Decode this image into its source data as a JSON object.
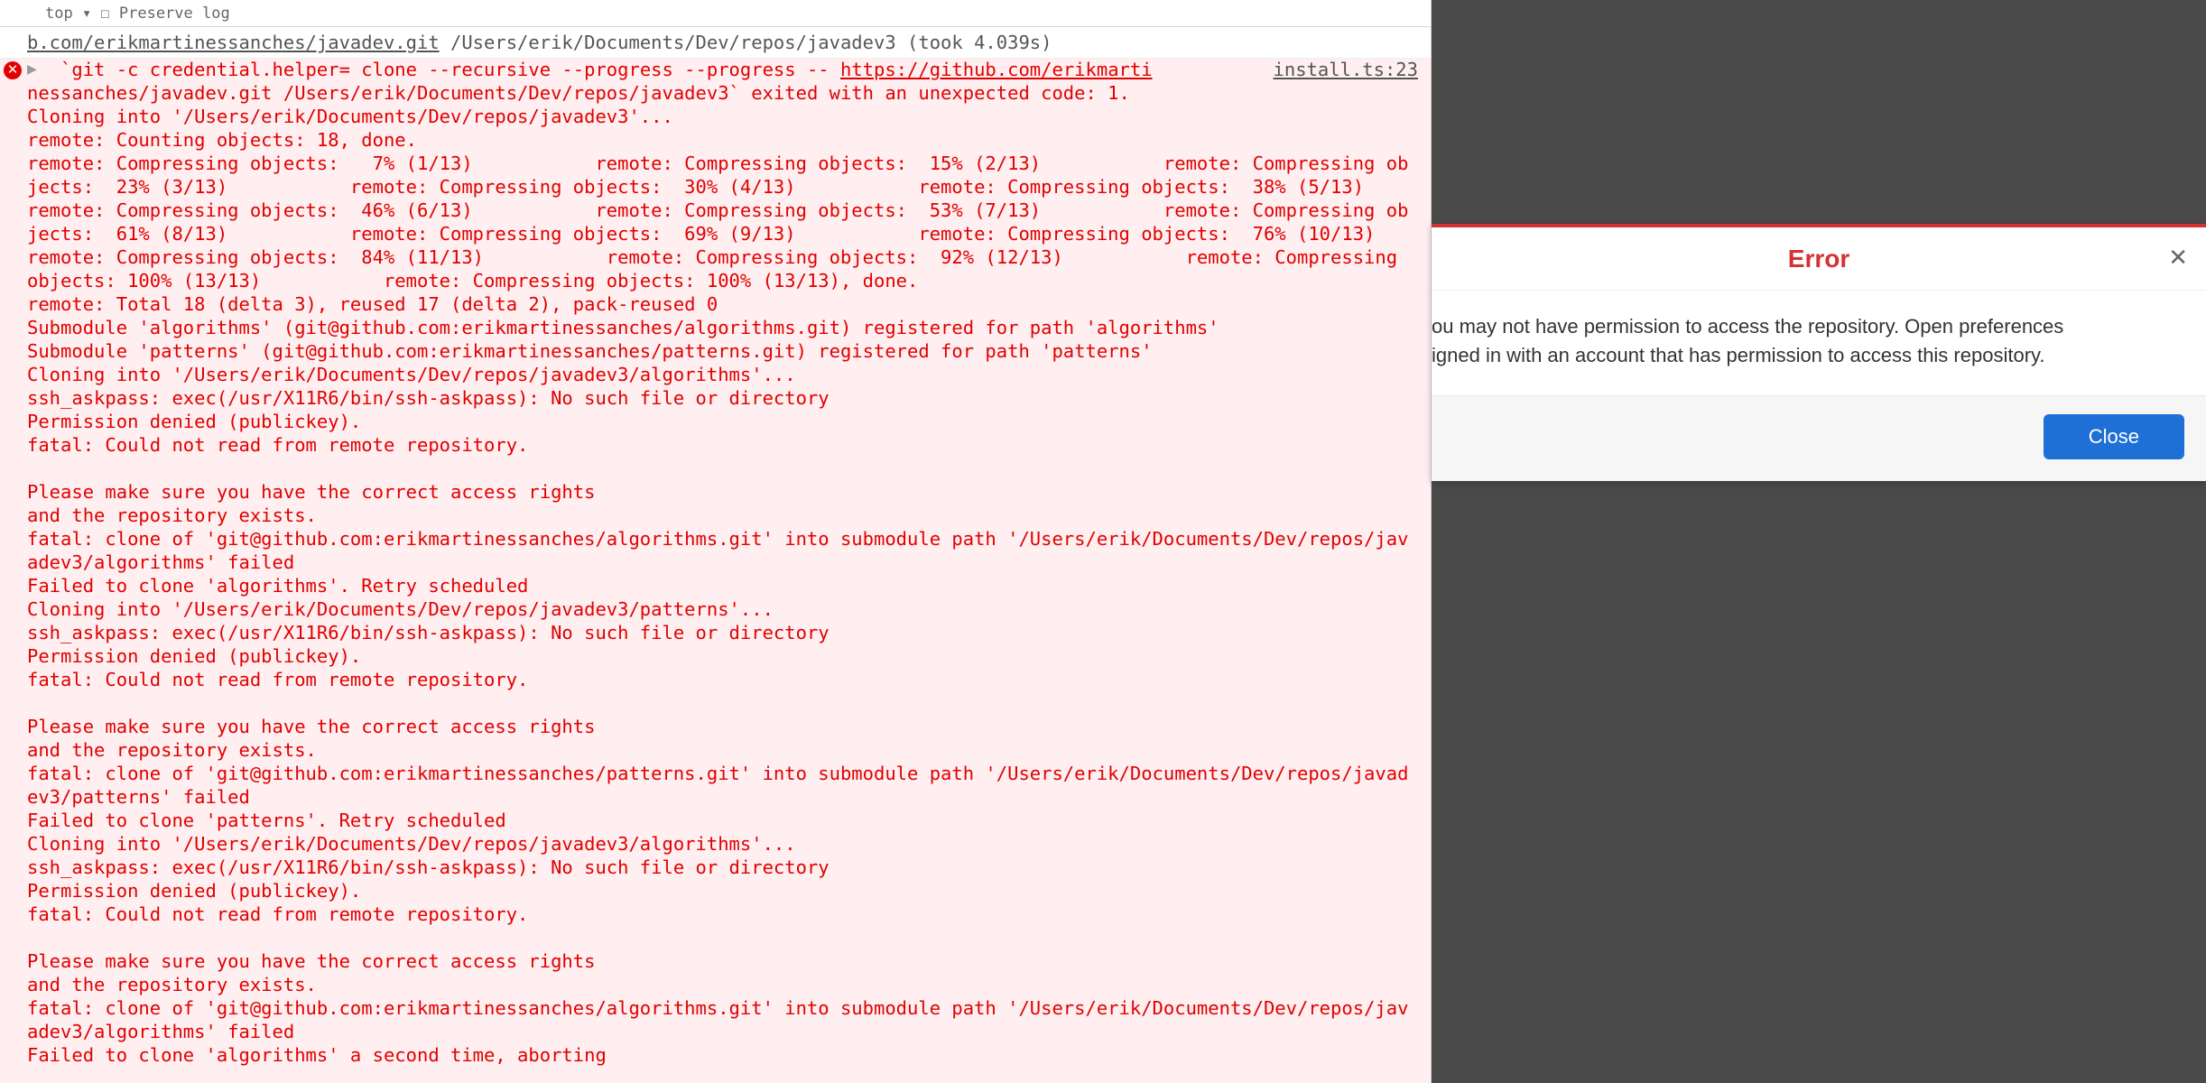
{
  "colors": {
    "error": "#e10000",
    "dialogAccent": "#d53232",
    "primaryBtn": "#1e6fd6"
  },
  "console": {
    "topFragment": "top   ▾   ☐  Preserve log",
    "summary_prefix": "b.com/erikmartinessanches/javadev.git",
    "summary_rest": " /Users/erik/Documents/Dev/repos/javadev3 (took 4.039s)",
    "src_link": "install.ts:23",
    "cmd_prefix": "`git -c credential.helper= clone --recursive --progress --progress -- ",
    "cmd_url": "https://github.com/erikmarti",
    "body": "nessanches/javadev.git /Users/erik/Documents/Dev/repos/javadev3` exited with an unexpected code: 1.\nCloning into '/Users/erik/Documents/Dev/repos/javadev3'...\nremote: Counting objects: 18, done.\nremote: Compressing objects:   7% (1/13)           remote: Compressing objects:  15% (2/13)           remote: Compressing objects:  23% (3/13)           remote: Compressing objects:  30% (4/13)           remote: Compressing objects:  38% (5/13)           remote: Compressing objects:  46% (6/13)           remote: Compressing objects:  53% (7/13)           remote: Compressing objects:  61% (8/13)           remote: Compressing objects:  69% (9/13)           remote: Compressing objects:  76% (10/13)           remote: Compressing objects:  84% (11/13)           remote: Compressing objects:  92% (12/13)           remote: Compressing objects: 100% (13/13)           remote: Compressing objects: 100% (13/13), done.\nremote: Total 18 (delta 3), reused 17 (delta 2), pack-reused 0\nSubmodule 'algorithms' (git@github.com:erikmartinessanches/algorithms.git) registered for path 'algorithms'\nSubmodule 'patterns' (git@github.com:erikmartinessanches/patterns.git) registered for path 'patterns'\nCloning into '/Users/erik/Documents/Dev/repos/javadev3/algorithms'...\nssh_askpass: exec(/usr/X11R6/bin/ssh-askpass): No such file or directory\nPermission denied (publickey).\nfatal: Could not read from remote repository.\n\nPlease make sure you have the correct access rights\nand the repository exists.\nfatal: clone of 'git@github.com:erikmartinessanches/algorithms.git' into submodule path '/Users/erik/Documents/Dev/repos/javadev3/algorithms' failed\nFailed to clone 'algorithms'. Retry scheduled\nCloning into '/Users/erik/Documents/Dev/repos/javadev3/patterns'...\nssh_askpass: exec(/usr/X11R6/bin/ssh-askpass): No such file or directory\nPermission denied (publickey).\nfatal: Could not read from remote repository.\n\nPlease make sure you have the correct access rights\nand the repository exists.\nfatal: clone of 'git@github.com:erikmartinessanches/patterns.git' into submodule path '/Users/erik/Documents/Dev/repos/javadev3/patterns' failed\nFailed to clone 'patterns'. Retry scheduled\nCloning into '/Users/erik/Documents/Dev/repos/javadev3/algorithms'...\nssh_askpass: exec(/usr/X11R6/bin/ssh-askpass): No such file or directory\nPermission denied (publickey).\nfatal: Could not read from remote repository.\n\nPlease make sure you have the correct access rights\nand the repository exists.\nfatal: clone of 'git@github.com:erikmartinessanches/algorithms.git' into submodule path '/Users/erik/Documents/Dev/repos/javadev3/algorithms' failed\nFailed to clone 'algorithms' a second time, aborting"
  },
  "dialog": {
    "title": "Error",
    "body": "ou may not have permission to access the repository. Open preferences igned in with an account that has permission to access this repository.",
    "body_line1": "ou may not have permission to access the repository. Open preferences",
    "body_line2": "igned in with an account that has permission to access this repository.",
    "close_btn": "Close"
  }
}
